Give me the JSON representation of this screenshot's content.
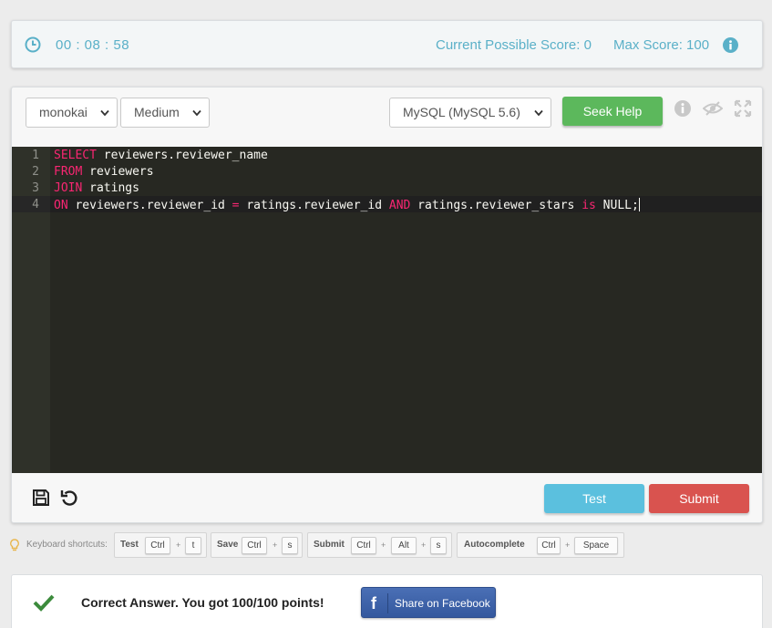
{
  "timer": {
    "value": "00 : 08 : 58"
  },
  "score": {
    "current": "Current Possible Score: 0",
    "max": "Max Score: 100"
  },
  "toolbar": {
    "theme": "monokai",
    "font_size": "Medium",
    "language": "MySQL (MySQL 5.6)",
    "seek_help_label": "Seek Help"
  },
  "editor": {
    "line_numbers": [
      "1",
      "2",
      "3",
      "4"
    ],
    "lines": [
      [
        {
          "t": "SELECT",
          "k": true
        },
        {
          "t": " reviewers.reviewer_name",
          "k": false
        }
      ],
      [
        {
          "t": "FROM",
          "k": true
        },
        {
          "t": " reviewers",
          "k": false
        }
      ],
      [
        {
          "t": "JOIN",
          "k": true
        },
        {
          "t": " ratings",
          "k": false
        }
      ],
      [
        {
          "t": "ON",
          "k": true
        },
        {
          "t": " reviewers.reviewer_id ",
          "k": false
        },
        {
          "t": "=",
          "k": true
        },
        {
          "t": " ratings.reviewer_id ",
          "k": false
        },
        {
          "t": "AND",
          "k": true
        },
        {
          "t": " ratings.reviewer_stars ",
          "k": false
        },
        {
          "t": "is",
          "k": true
        },
        {
          "t": " NULL;",
          "k": false
        }
      ]
    ]
  },
  "actions": {
    "test_label": "Test",
    "submit_label": "Submit"
  },
  "shortcuts": {
    "label": "Keyboard shortcuts:",
    "items": [
      {
        "name": "Test",
        "keys": [
          "Ctrl",
          "t"
        ]
      },
      {
        "name": "Save",
        "keys": [
          "Ctrl",
          "s"
        ]
      },
      {
        "name": "Submit",
        "keys": [
          "Ctrl",
          "Alt",
          "s"
        ]
      },
      {
        "name": "Autocomplete",
        "keys": [
          "Ctrl",
          "Space"
        ]
      }
    ],
    "plus": "+"
  },
  "result": {
    "message": "Correct Answer. You got 100/100 points!",
    "share_label": "Share on Facebook"
  },
  "colors": {
    "accent": "#5ab0c8",
    "help": "#5cb85c",
    "test": "#5bc0de",
    "submit": "#d9534f",
    "editor_bg": "#272822",
    "keyword": "#f92672",
    "facebook": "#3b5998"
  },
  "icons": [
    "clock-icon",
    "info-icon",
    "eye-slash-icon",
    "expand-icon",
    "save-icon",
    "undo-icon",
    "lightbulb-icon",
    "check-icon",
    "facebook-icon"
  ]
}
